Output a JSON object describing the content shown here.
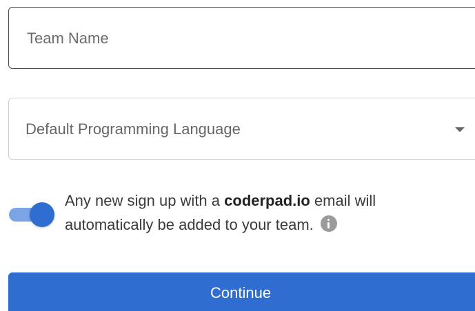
{
  "form": {
    "team_name": {
      "value": "",
      "placeholder": "Team Name"
    },
    "language_select": {
      "label": "Default Programming Language",
      "icon": "caret-down-icon"
    },
    "auto_join": {
      "enabled": true,
      "text_before": "Any new sign up with a ",
      "domain": "coderpad.io",
      "text_after": " email will automatically be added to your team.",
      "info_icon": "info-icon"
    },
    "continue_label": "Continue"
  },
  "colors": {
    "primary": "#2f6dd0",
    "toggle_track": "#7aa4e6",
    "info_icon": "#9a9a9a"
  }
}
